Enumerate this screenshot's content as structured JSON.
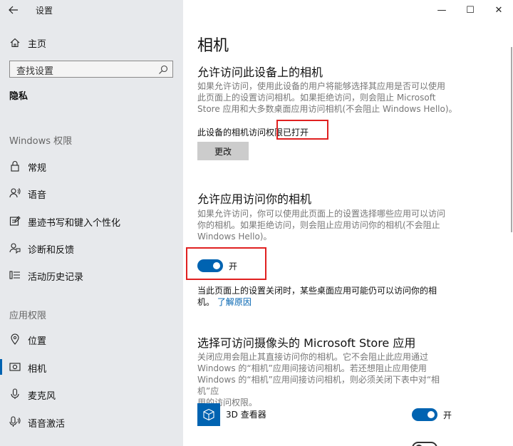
{
  "window": {
    "title": "设置",
    "controls": {
      "minimize": "—",
      "maximize": "☐",
      "close": "✕"
    }
  },
  "sidebar": {
    "home_label": "主页",
    "search_placeholder": "查找设置",
    "current_section": "隐私",
    "windows_permissions_header": "Windows 权限",
    "windows_items": [
      {
        "label": "常规",
        "icon": "lock-icon"
      },
      {
        "label": "语音",
        "icon": "speech-icon"
      },
      {
        "label": "墨迹书写和键入个性化",
        "icon": "inking-icon"
      },
      {
        "label": "诊断和反馈",
        "icon": "feedback-icon"
      },
      {
        "label": "活动历史记录",
        "icon": "activity-history-icon"
      }
    ],
    "app_permissions_header": "应用权限",
    "app_items": [
      {
        "label": "位置",
        "icon": "location-icon",
        "active": false
      },
      {
        "label": "相机",
        "icon": "camera-icon",
        "active": true
      },
      {
        "label": "麦克风",
        "icon": "microphone-icon",
        "active": false
      },
      {
        "label": "语音激活",
        "icon": "voice-activation-icon",
        "active": false
      }
    ]
  },
  "main": {
    "title": "相机",
    "section1": {
      "heading": "允许访问此设备上的相机",
      "desc_lines": [
        "如果允许访问，使用此设备的用户将能够选择其应用是否可以使用",
        "此页面上的设置访问相机。如果拒绝访问，则会阻止 Microsoft",
        "Store 应用和大多数桌面应用访问相机(不会阻止 Windows Hello)。"
      ],
      "status_prefix": "此设备的相机访问权限",
      "status_value": "已打开",
      "change_button": "更改"
    },
    "section2": {
      "heading": "允许应用访问你的相机",
      "desc_lines": [
        "如果允许访问，你可以使用此页面上的设置选择哪些应用可以访问",
        "你的相机。如果拒绝访问，则会阻止应用访问你的相机(不会阻止",
        "Windows Hello)。"
      ],
      "toggle_state": "on",
      "toggle_label": "开",
      "note_line1": "当此页面上的设置关闭时，某些桌面应用可能仍可以访问你的相",
      "note_line2_prefix": "机。",
      "learn_more_link": "了解原因"
    },
    "section3": {
      "heading": "选择可访问摄像头的 Microsoft Store 应用",
      "desc_lines": [
        "关闭应用会阻止其直接访问你的相机。它不会阻止此应用通过",
        "Windows 的“相机”应用间接访问相机。若还想阻止应用使用",
        "Windows 的“相机”应用间接访问相机，则必须关闭下表中对“相机”应",
        "用的访问权限。"
      ],
      "apps": [
        {
          "name": "3D 查看器",
          "state": "on",
          "state_label": "开",
          "icon": "3d-viewer-icon"
        }
      ]
    }
  },
  "colors": {
    "accent": "#0063b1",
    "sidebar_bg": "#e7e9ec",
    "highlight_box": "#e02020"
  }
}
